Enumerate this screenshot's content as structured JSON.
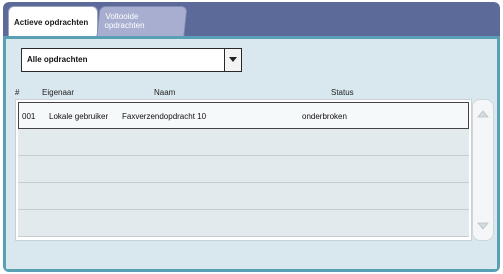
{
  "tabs": {
    "active_label": "Actieve opdrachten",
    "completed_line1": "Voltooide",
    "completed_line2": "opdrachten"
  },
  "filter": {
    "selected": "Alle opdrachten"
  },
  "table": {
    "headers": {
      "number": "#",
      "owner": "Eigenaar",
      "name": "Naam",
      "status": "Status"
    },
    "rows": [
      {
        "number": "001",
        "owner": "Lokale gebruiker",
        "name": "Faxverzendopdracht 10",
        "status": "onderbroken"
      }
    ]
  },
  "icons": {
    "dropdown": "chevron-down-icon",
    "scroll_up": "scroll-up-icon",
    "scroll_down": "scroll-down-icon"
  },
  "colors": {
    "tabbar": "#5b6a98",
    "panel_border": "#5aa0b4",
    "panel_bg": "#d9e8ef"
  }
}
